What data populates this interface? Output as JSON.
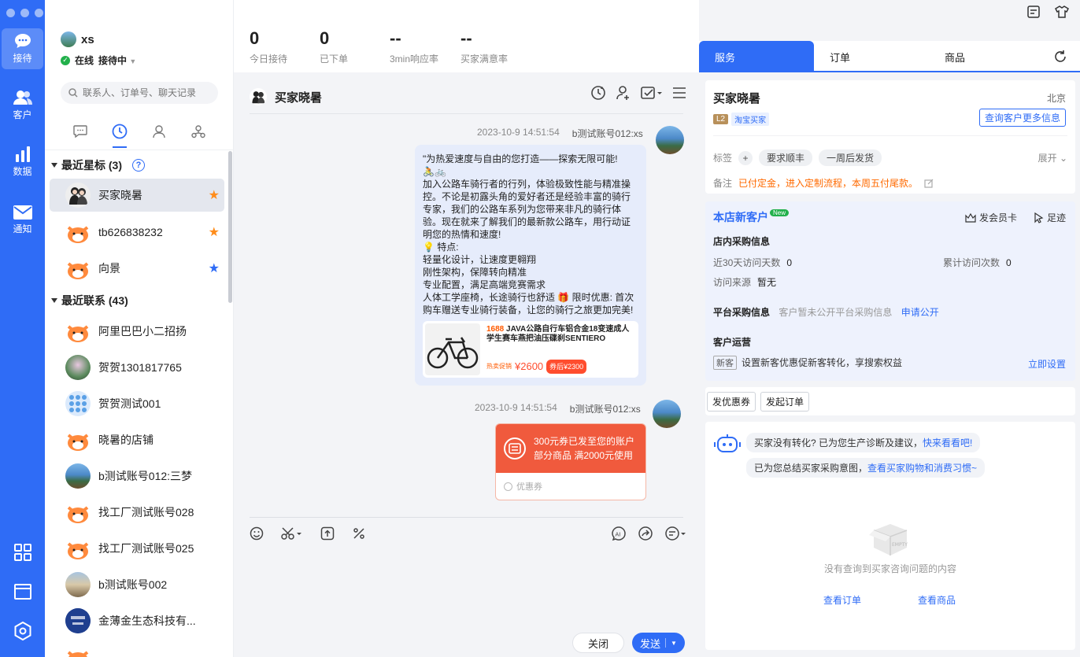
{
  "user": {
    "name": "xs",
    "status": "在线",
    "mode": "接待中"
  },
  "rail": {
    "items": [
      {
        "label": "接待",
        "icon": "chat-icon"
      },
      {
        "label": "客户",
        "icon": "customers-icon"
      },
      {
        "label": "数据",
        "icon": "bar-chart-icon"
      },
      {
        "label": "通知",
        "icon": "mail-icon"
      }
    ]
  },
  "search": {
    "placeholder": "联系人、订单号、聊天记录"
  },
  "groups": {
    "starred": "最近星标 (3)",
    "recent": "最近联系 (43)"
  },
  "starred": [
    {
      "name": "买家晓暑",
      "star_color": "#ff8c1a"
    },
    {
      "name": "tb626838232",
      "star_color": "#ff8c1a"
    },
    {
      "name": "向景",
      "star_color": "#2f6cf6"
    }
  ],
  "recent": [
    {
      "name": "阿里巴巴小二招扬"
    },
    {
      "name": "贺贺1301817765"
    },
    {
      "name": "贺贺测试001"
    },
    {
      "name": "晓暑的店铺"
    },
    {
      "name": "b测试账号012:三梦"
    },
    {
      "name": "找工厂测试账号028"
    },
    {
      "name": "找工厂测试账号025"
    },
    {
      "name": "b测试账号002"
    },
    {
      "name": "金薄金生态科技有..."
    }
  ],
  "stats": [
    {
      "value": "0",
      "label": "今日接待"
    },
    {
      "value": "0",
      "label": "已下单"
    },
    {
      "value": "--",
      "label": "3min响应率"
    },
    {
      "value": "--",
      "label": "买家满意率"
    }
  ],
  "chat": {
    "title": "买家晓暑",
    "msg1": {
      "time": "2023-10-9 14:51:54",
      "sender": "b测试账号012:xs",
      "lines": [
        "\"为热爱速度与自由的您打造——探索无限可能!",
        "🚴🚲",
        "加入公路车骑行者的行列，体验极致性能与精准操控。不论是初露头角的爱好者还是经验丰富的骑行专家，我们的公路车系列为您带来非凡的骑行体验。现在就来了解我们的最新款公路车，用行动证明您的热情和速度!",
        "💡 特点:",
        "轻量化设计，让速度更翱翔",
        "刚性架构，保障转向精准",
        "专业配置，满足高端竞赛需求",
        "人体工学座椅，长途骑行也舒适 🎁 限时优惠: 首次购车赠送专业骑行装备，让您的骑行之旅更加完美!"
      ],
      "product": {
        "brand": "1688",
        "title": "JAVA公路自行车铝合金18变速成人学生赛车燕把油压碟刹SENTIERO",
        "price_label": "热卖促销",
        "price": "¥2600",
        "badge": "券后¥2300"
      }
    },
    "msg2": {
      "time": "2023-10-9 14:51:54",
      "sender": "b测试账号012:xs",
      "coupon_line1": "300元券已发至您的账户",
      "coupon_line2": "部分商品 满2000元使用",
      "coupon_footer": "优惠券"
    },
    "close_label": "关闭",
    "send_label": "发送"
  },
  "right": {
    "tabs": [
      "服务",
      "订单",
      "商品"
    ],
    "buyer": {
      "name": "买家晓暑",
      "city": "北京",
      "level": "L2",
      "platform": "淘宝买家",
      "more_btn": "查询客户更多信息"
    },
    "tags_label": "标签",
    "tags": [
      "要求顺丰",
      "一周后发货"
    ],
    "expand": "展开",
    "note_label": "备注",
    "note": "已付定金，进入定制流程，本周五付尾款。",
    "new_customer": "本店新客户",
    "new_badge": "New",
    "member_card": "发会员卡",
    "footprint": "足迹",
    "shop_info_title": "店内采购信息",
    "visit_days_label": "近30天访问天数",
    "visit_days": "0",
    "visit_count_label": "累计访问次数",
    "visit_count": "0",
    "source_label": "访问来源",
    "source": "暂无",
    "platform_title": "平台采购信息",
    "platform_note": "客户暂未公开平台采购信息",
    "apply_public": "申请公开",
    "ops_title": "客户运营",
    "ops_badge": "新客",
    "ops_text": "设置新客优惠促新客转化，享搜索权益",
    "ops_link": "立即设置",
    "btn_coupon": "发优惠券",
    "btn_order": "发起订单",
    "ai_line1_text": "买家没有转化? 已为您生产诊断及建议，",
    "ai_line1_link": "快来看看吧!",
    "ai_line2_text": "已为您总结买家采购意图，",
    "ai_line2_link": "查看买家购物和消费习惯~",
    "empty": "没有查询到买家咨询问题的内容",
    "view_order": "查看订单",
    "view_goods": "查看商品",
    "empty_box_text": "EMPTY"
  }
}
